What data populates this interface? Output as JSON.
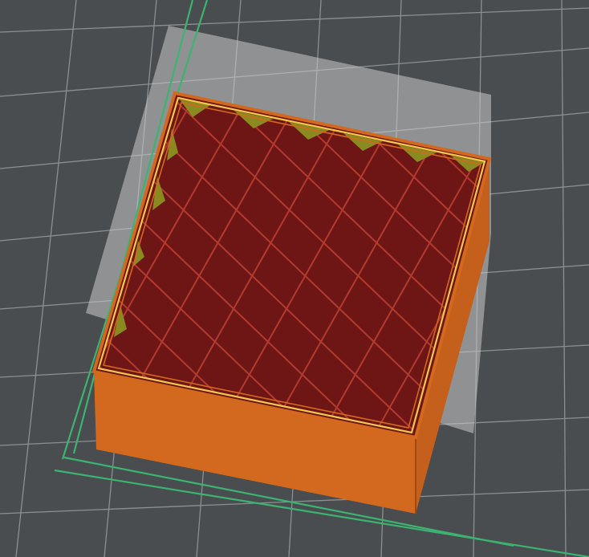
{
  "colors": {
    "background": "#4a4d4f",
    "grid_line": "#8c8f91",
    "grid_line_major": "#b5b7b8",
    "bed_boundary": "#3cb371",
    "build_plate_highlight": "#c8cacb",
    "wall_outer": "#d2691e",
    "wall_outer_dark": "#b8561a",
    "wall_side": "#c45f1c",
    "perimeter_inner": "#f2c94c",
    "infill_bg": "#6e1616",
    "infill_line": "#b23a2e",
    "infill_shade": "#581010",
    "gap_fill": "#8a8a20"
  },
  "icons": {
    "object": "printed-box-model-icon"
  }
}
